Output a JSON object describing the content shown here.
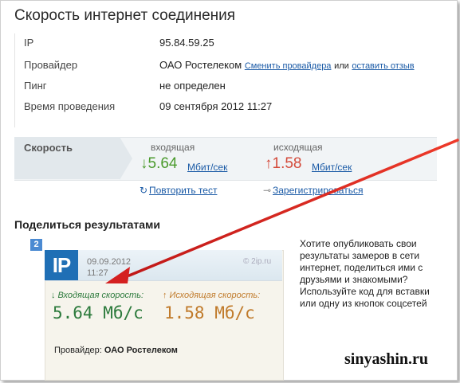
{
  "page": {
    "title": "Скорость интернет соединения"
  },
  "info": {
    "rows": [
      {
        "label": "IP",
        "value": "95.84.59.25"
      },
      {
        "label": "Провайдер",
        "value": "ОАО Ростелеком"
      },
      {
        "label": "Пинг",
        "value": "не определен"
      },
      {
        "label": "Время проведения",
        "value": "09 сентября 2012 11:27"
      }
    ],
    "change_provider_link": "Сменить провайдера",
    "or_text": "или",
    "leave_review_link": "оставить отзыв"
  },
  "speed": {
    "label": "Скорость",
    "incoming": {
      "label": "входящая",
      "arrow": "↓",
      "value": "5.64",
      "unit": "Мбит/сек",
      "color": "#4a9a2c"
    },
    "outgoing": {
      "label": "исходящая",
      "arrow": "↑",
      "value": "1.58",
      "unit": "Мбит/сек",
      "color": "#d44a3a"
    },
    "repeat_link": "Повторить тест",
    "register_link": "Зарегистрироваться"
  },
  "share": {
    "title": "Поделиться результатами",
    "badge": "2",
    "card": {
      "logo": "IP",
      "date": "09.09.2012",
      "time": "11:27",
      "brand": "© 2ip.ru",
      "incoming_label": "↓ Входящая скорость:",
      "incoming_value": "5.64 Мб/с",
      "outgoing_label": "↑ Исходящая скорость:",
      "outgoing_value": "1.58 Мб/с",
      "provider_label": "Провайдер:",
      "provider_value": "ОАО Ростелеком"
    },
    "description": "Хотите опубликовать свои результаты замеров в сети интернет, поделиться ими с друзьями и знакомыми? Используйте код для вставки или одну из кнопок соцсетей"
  },
  "watermark": "sinyashin.ru",
  "colors": {
    "link": "#1a5aa6",
    "arrow_annotation": "#e02020",
    "card_green": "#2c7a3c",
    "card_orange": "#c07a2a"
  }
}
